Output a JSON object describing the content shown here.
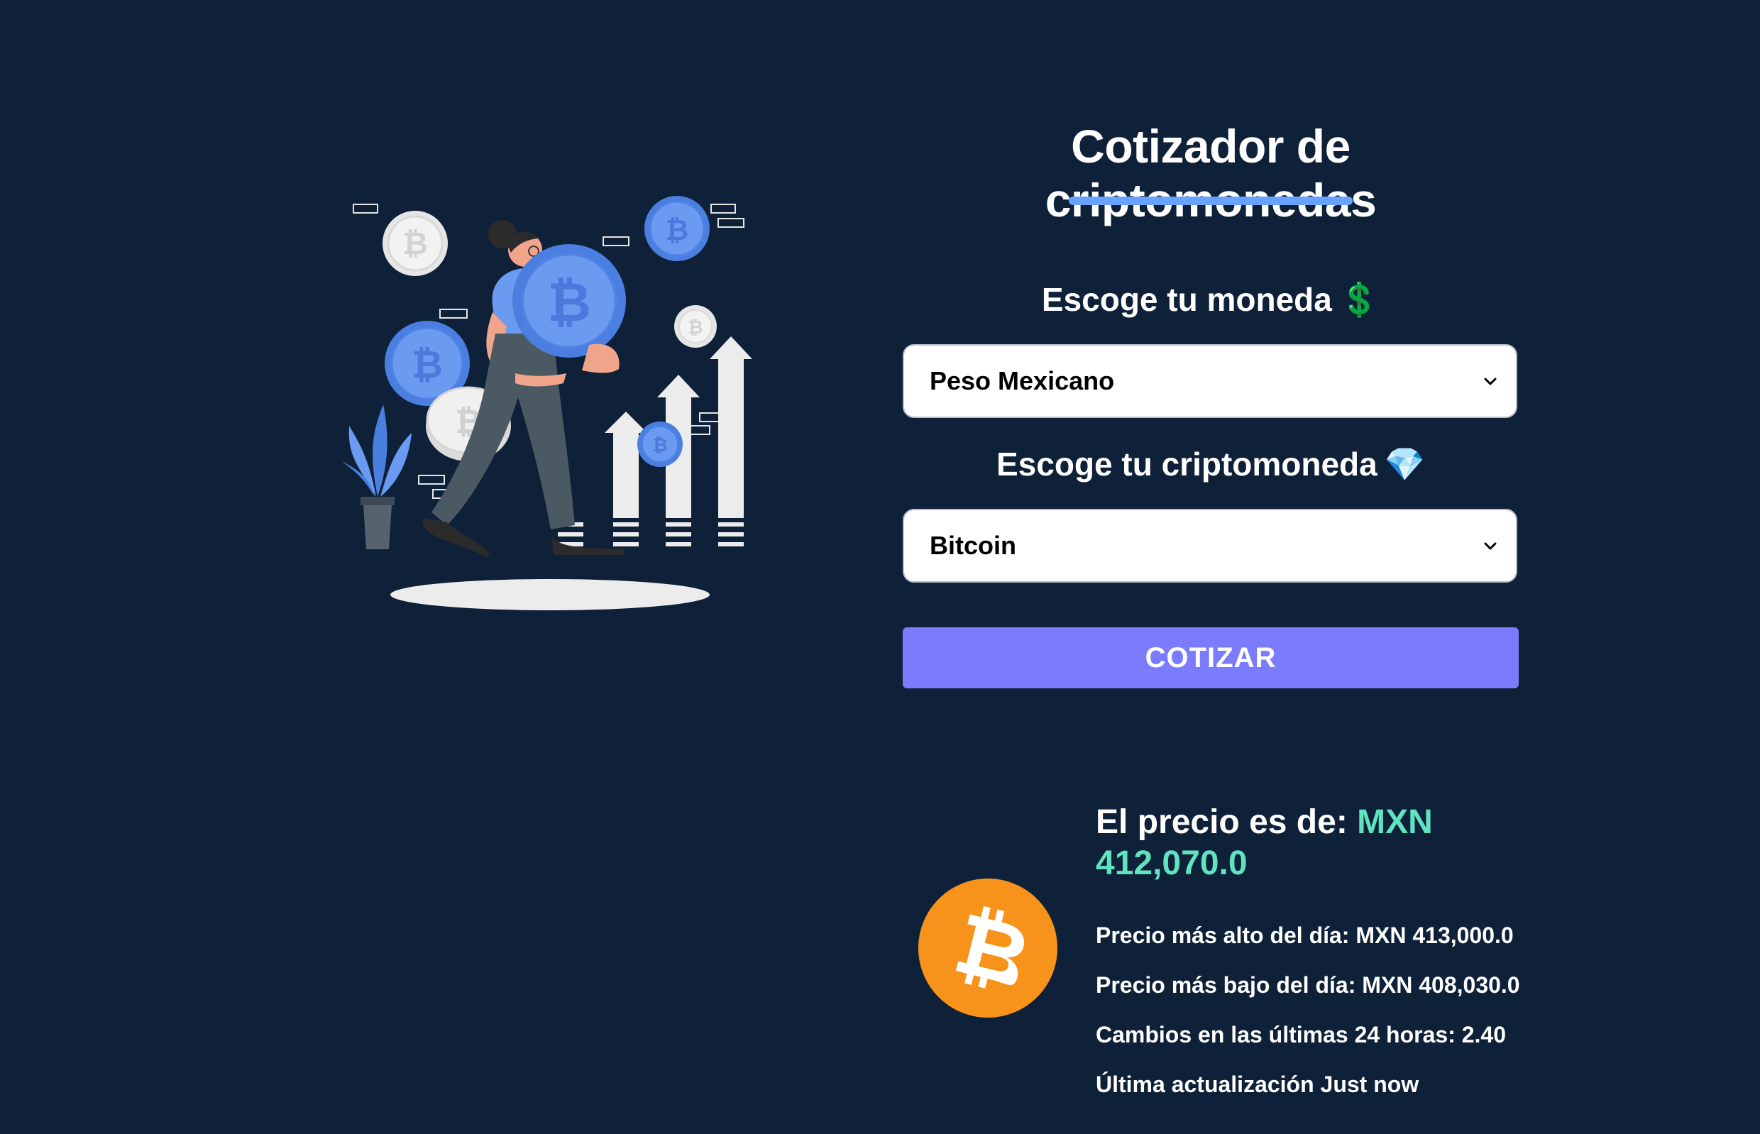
{
  "title": "Cotizador de criptomonedas",
  "currency_field": {
    "label": "Escoge tu moneda",
    "emoji": "💲",
    "selected": "Peso Mexicano"
  },
  "crypto_field": {
    "label": "Escoge tu criptomoneda",
    "emoji": "💎",
    "selected": "Bitcoin"
  },
  "submit_label": "COTIZAR",
  "result": {
    "price_prefix": "El precio es de: ",
    "price_value": "MXN 412,070.0",
    "high": "Precio más alto del día: MXN 413,000.0",
    "low": "Precio más bajo del día: MXN 408,030.0",
    "change": "Cambios en las últimas 24 horas: 2.40",
    "updated": "Última actualización Just now"
  },
  "colors": {
    "background": "#0e2139",
    "accent_bar": "#66a2fe",
    "button": "#7a7bfd",
    "price_value": "#5fe3c0",
    "bitcoin": "#f7931a"
  },
  "icons": {
    "hero": "crypto-investor-illustration",
    "coin": "bitcoin-icon",
    "select_arrow": "chevron-down-icon"
  }
}
